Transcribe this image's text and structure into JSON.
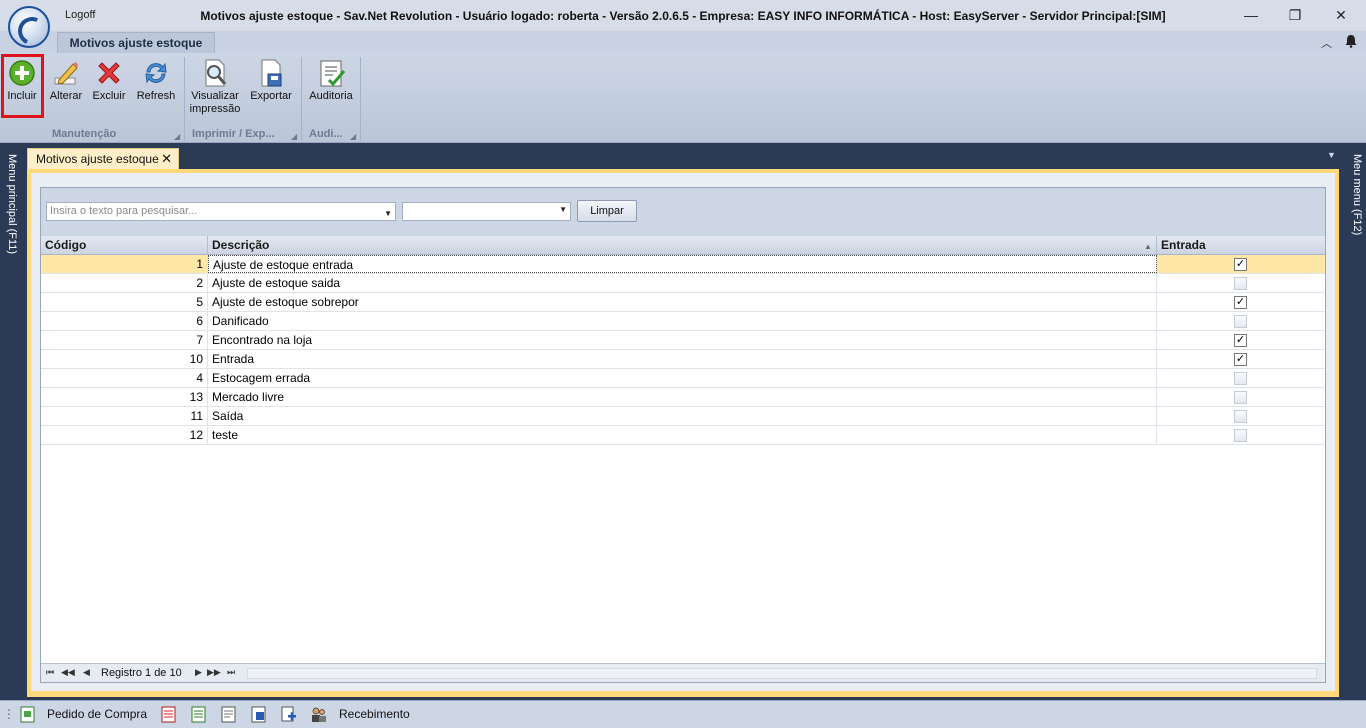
{
  "window": {
    "logoff_label": "Logoff",
    "title": "Motivos ajuste estoque - Sav.Net Revolution - Usuário logado: roberta - Versão 2.0.6.5 - Empresa: EASY INFO INFORMÁTICA - Host: EasyServer - Servidor Principal:[SIM]",
    "minimize_glyph": "—",
    "maximize_glyph": "❐",
    "close_glyph": "✕"
  },
  "ribbon": {
    "tab_label": "Motivos ajuste estoque",
    "collapse_glyph": "︿",
    "buttons": {
      "incluir": "Incluir",
      "alterar": "Alterar",
      "excluir": "Excluir",
      "refresh": "Refresh",
      "visualizar_line1": "Visualizar",
      "visualizar_line2": "impressão",
      "exportar": "Exportar",
      "auditoria": "Auditoria"
    },
    "groups": {
      "manutencao": "Manutenção",
      "imprimir": "Imprimir / Exp...",
      "auditoria": "Audi..."
    },
    "group_corner_glyph": "◢"
  },
  "side": {
    "left_label": "Menu principal (F11)",
    "right_label": "Meu menu (F12)"
  },
  "document": {
    "tab_label": "Motivos ajuste estoque",
    "close_glyph": "✕",
    "tab_menu_glyph": "▼"
  },
  "grid": {
    "search_placeholder": "Insira o texto para pesquisar...",
    "filter_value": "",
    "clear_label": "Limpar",
    "dropdown_glyph": "▼",
    "sort_glyph": "▲",
    "check_glyph": "✓",
    "columns": [
      "Código",
      "Descrição",
      "Entrada"
    ],
    "rows": [
      {
        "code": "1",
        "description": "Ajuste de estoque entrada",
        "entrada": true
      },
      {
        "code": "2",
        "description": "Ajuste de estoque saida",
        "entrada": false
      },
      {
        "code": "5",
        "description": "Ajuste de estoque sobrepor",
        "entrada": true
      },
      {
        "code": "6",
        "description": "Danificado",
        "entrada": false
      },
      {
        "code": "7",
        "description": "Encontrado na loja",
        "entrada": true
      },
      {
        "code": "10",
        "description": "Entrada",
        "entrada": true
      },
      {
        "code": "4",
        "description": "Estocagem errada",
        "entrada": false
      },
      {
        "code": "13",
        "description": "Mercado livre",
        "entrada": false
      },
      {
        "code": "11",
        "description": "Saída",
        "entrada": false
      },
      {
        "code": "12",
        "description": "teste",
        "entrada": false
      }
    ],
    "selected_index": 0,
    "footer": {
      "record_info": "Registro 1 de 10",
      "nav_first": "⏮",
      "nav_prev_page": "◀◀",
      "nav_prev": "◀",
      "nav_next": "▶",
      "nav_next_page": "▶▶",
      "nav_last": "⏭"
    }
  },
  "taskbar": {
    "grip_glyph": "⋮",
    "pedido_label": "Pedido de Compra",
    "recebimento_label": "Recebimento"
  },
  "colors": {
    "accent_red": "#e0131d",
    "selected_row": "#ffe8a6",
    "frame_gold": "#ffd97a",
    "dark_bg": "#2b3a55"
  }
}
